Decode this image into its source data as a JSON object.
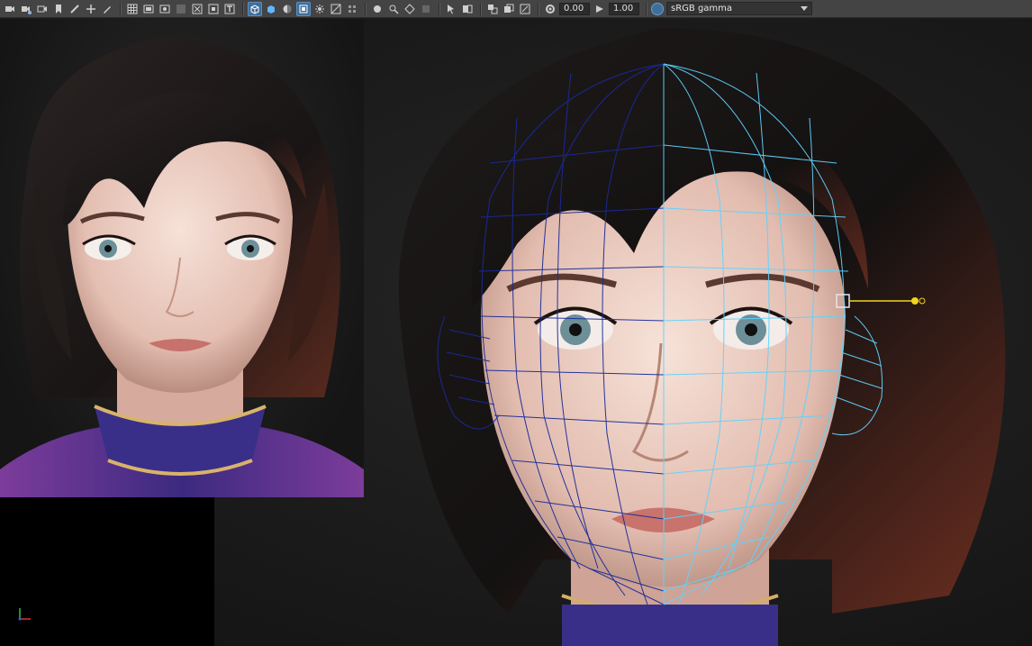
{
  "toolbar": {
    "exposure_value": "0.00",
    "gamma_value": "1.00",
    "color_space": "sRGB gamma",
    "icons": [
      "camera-icon",
      "camera-attributes-icon",
      "bookmark-camera-icon",
      "image-plane-icon",
      "pencil-icon",
      "pan-icon",
      "grease-pencil-icon",
      "grid-icon",
      "film-gate-icon",
      "resolution-gate-icon",
      "gate-mask-icon",
      "field-chart-icon",
      "safe-action-icon",
      "safe-title-icon",
      "wireframe-icon",
      "smooth-shade-icon",
      "default-material-icon",
      "xray-icon",
      "textured-icon",
      "lighting-icon",
      "shadows-icon",
      "isolate-icon",
      "xray-joints-icon",
      "xray-active-icon",
      "backface-icon",
      "select-camera-icon",
      "two-panel-icon",
      "multi-panel-icon",
      "resolution-icon",
      "exposure-icon",
      "gamma-icon",
      "color-management-icon"
    ]
  },
  "colors": {
    "toolbar_bg": "#444444",
    "active_button": "#3f6e99",
    "wire_dark": "#1a2a9a",
    "wire_light": "#5fd3ff",
    "locator": "#f2d320"
  }
}
